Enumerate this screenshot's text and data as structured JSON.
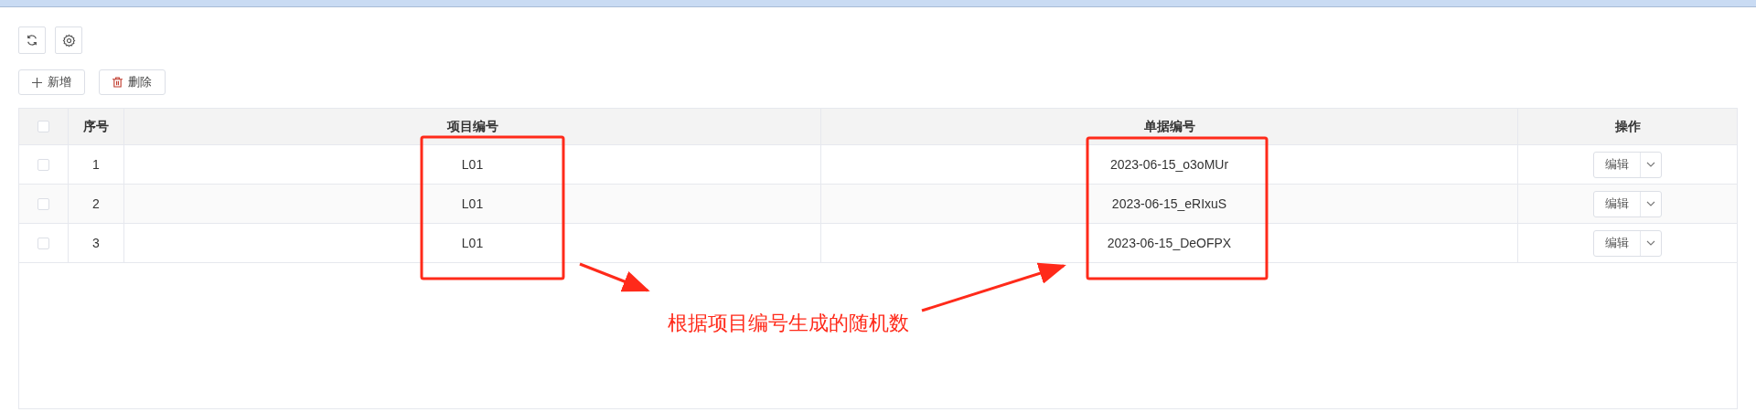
{
  "toolbar": {
    "buttons": [
      {
        "kind": "refresh"
      },
      {
        "kind": "settings"
      }
    ]
  },
  "actions": [
    {
      "kind": "add",
      "label": "新增"
    },
    {
      "kind": "delete",
      "label": "删除"
    }
  ],
  "table": {
    "all_checked": false,
    "columns": [
      "序号",
      "项目编号",
      "单据编号",
      "操作"
    ],
    "rows": [
      {
        "checked": false,
        "index": "1",
        "project_no": "L01",
        "doc_no": "2023-06-15_o3oMUr",
        "action": "编辑"
      },
      {
        "checked": false,
        "index": "2",
        "project_no": "L01",
        "doc_no": "2023-06-15_eRIxuS",
        "action": "编辑"
      },
      {
        "checked": false,
        "index": "3",
        "project_no": "L01",
        "doc_no": "2023-06-15_DeOFPX",
        "action": "编辑"
      }
    ]
  },
  "annotation": {
    "text": "根据项目编号生成的随机数"
  }
}
